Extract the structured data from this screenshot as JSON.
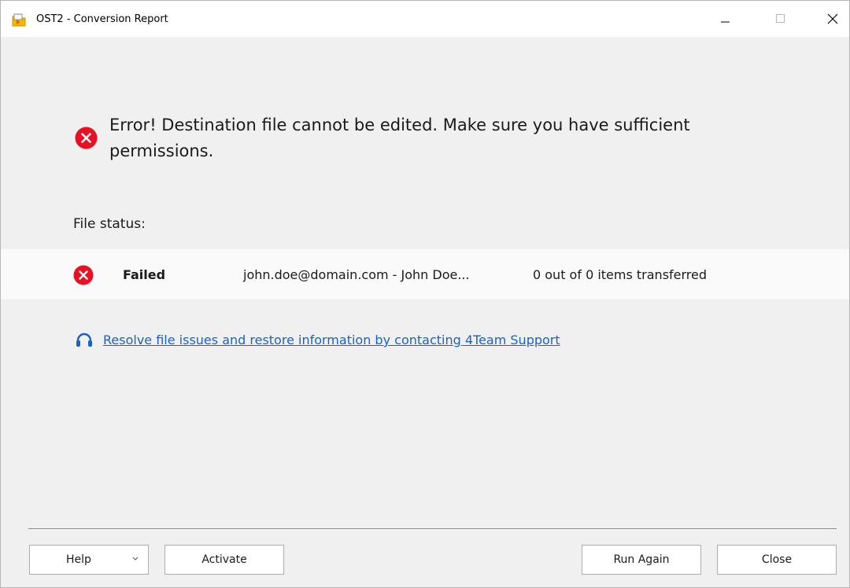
{
  "window": {
    "title": "OST2 - Conversion Report",
    "icon": "app-folder-icon"
  },
  "error": {
    "icon": "error-circle-icon",
    "message": "Error! Destination file cannot be edited. Make sure you have sufficient permissions."
  },
  "file_status": {
    "label": "File status:",
    "rows": [
      {
        "icon": "error-circle-icon",
        "status": "Failed",
        "account": "john.doe@domain.com - John Doe...",
        "items": "0 out of 0 items transferred"
      }
    ]
  },
  "support": {
    "icon": "headset-icon",
    "link_text": "Resolve file issues and restore information by contacting 4Team Support"
  },
  "buttons": {
    "help": "Help",
    "activate": "Activate",
    "run_again": "Run Again",
    "close": "Close"
  },
  "colors": {
    "error_red": "#e81123",
    "link_blue": "#1a63c6",
    "window_bg": "#f0f0f0"
  }
}
